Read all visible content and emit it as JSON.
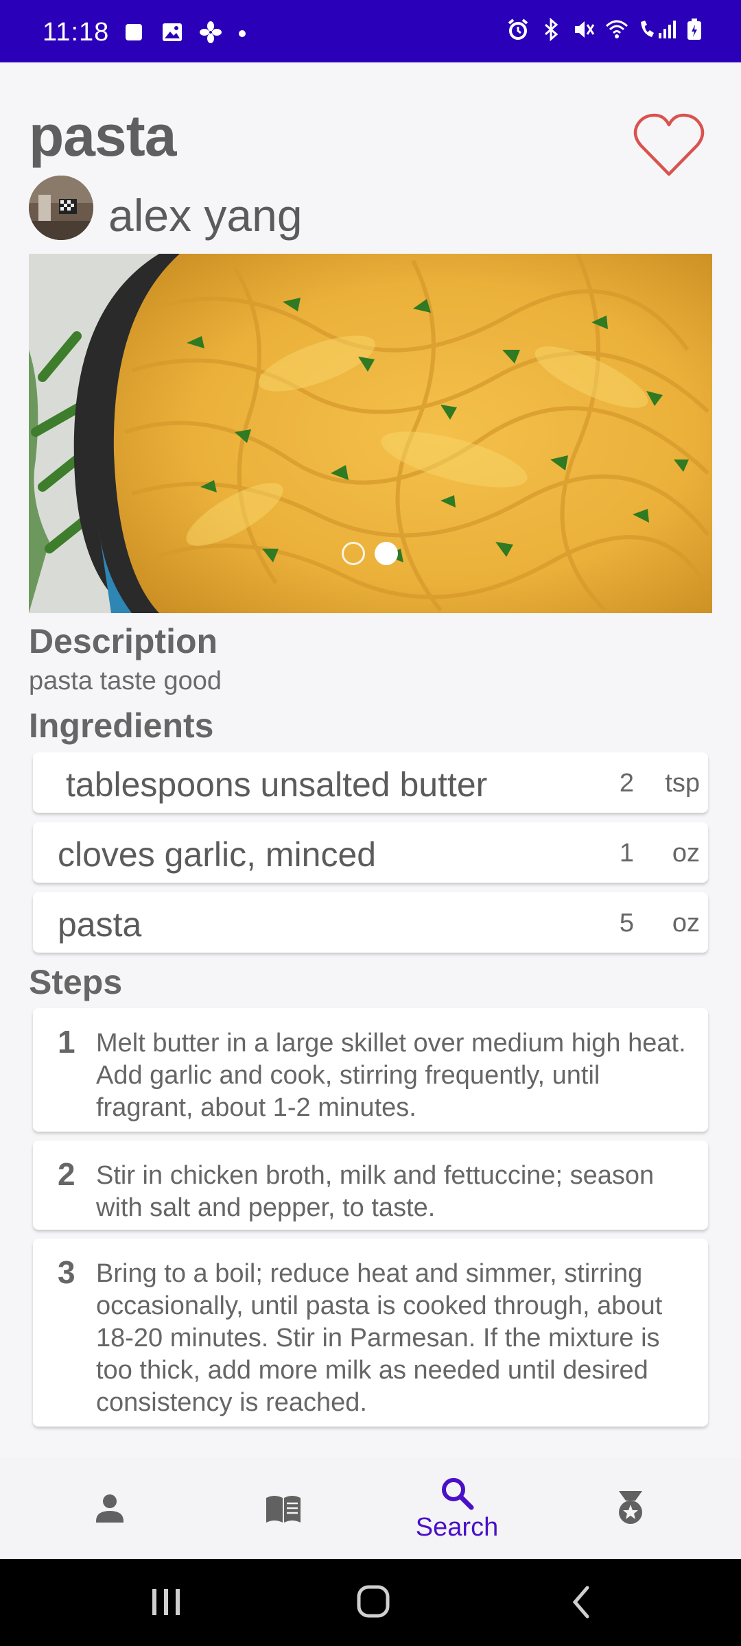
{
  "status_bar": {
    "time": "11:18",
    "left_icons": [
      "stop-icon",
      "image-icon",
      "fan-icon",
      "dot-icon"
    ],
    "right_icons": [
      "alarm-icon",
      "bluetooth-icon",
      "mute-icon",
      "wifi-icon",
      "call-signal-icon",
      "battery-icon"
    ]
  },
  "recipe": {
    "title": "pasta",
    "author": "alex yang",
    "favorite_icon": "heart-outline-icon",
    "carousel": {
      "pages": 2,
      "active_index": 1
    }
  },
  "description": {
    "heading": "Description",
    "text": "pasta taste good"
  },
  "ingredients": {
    "heading": "Ingredients",
    "items": [
      {
        "name": "tablespoons unsalted butter",
        "qty": "2",
        "unit": "tsp"
      },
      {
        "name": "cloves garlic, minced",
        "qty": "1",
        "unit": "oz"
      },
      {
        "name": "pasta",
        "qty": "5",
        "unit": "oz"
      }
    ]
  },
  "steps": {
    "heading": "Steps",
    "items": [
      {
        "num": "1",
        "text": "Melt butter in a large skillet over medium high heat. Add garlic and cook, stirring frequently, until fragrant, about 1-2 minutes."
      },
      {
        "num": "2",
        "text": "Stir in chicken broth, milk and fettuccine; season with salt and pepper, to taste."
      },
      {
        "num": "3",
        "text": "Bring to a boil; reduce heat and simmer, stirring occasionally, until pasta is cooked through, about 18-20 minutes. Stir in Parmesan. If the mixture is too thick, add more milk as needed until desired consistency is reached."
      }
    ]
  },
  "bottom_nav": {
    "items": [
      {
        "icon": "person-icon",
        "label": ""
      },
      {
        "icon": "book-icon",
        "label": ""
      },
      {
        "icon": "search-icon",
        "label": "Search",
        "active": true
      },
      {
        "icon": "award-icon",
        "label": ""
      }
    ],
    "active_color": "#4a10c8"
  },
  "system_nav": {
    "buttons": [
      "recents-icon",
      "home-icon",
      "back-icon"
    ]
  },
  "colors": {
    "status_bar": "#2a00b8",
    "heart": "#d9534f",
    "accent": "#4a10c8"
  }
}
